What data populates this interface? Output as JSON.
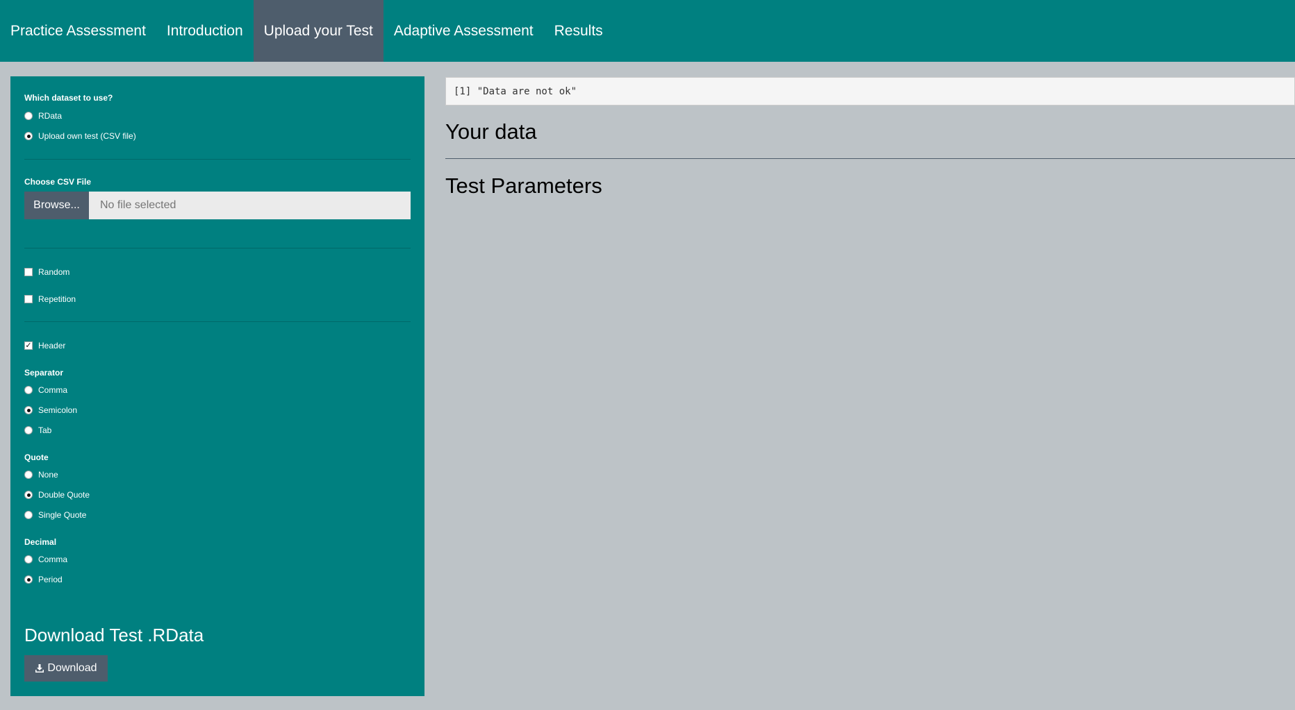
{
  "navbar": {
    "brand": "Practice Assessment",
    "tabs": [
      {
        "label": "Introduction"
      },
      {
        "label": "Upload your Test"
      },
      {
        "label": "Adaptive Assessment"
      },
      {
        "label": "Results"
      }
    ],
    "active_tab": "Upload your Test",
    "background": "#008080",
    "active_background": "#4e5d6c"
  },
  "sidebar": {
    "dataset": {
      "label": "Which dataset to use?",
      "options": [
        "RData",
        "Upload own test (CSV file)"
      ],
      "selected": "Upload own test (CSV file)"
    },
    "file": {
      "label": "Choose CSV File",
      "button": "Browse...",
      "placeholder": "No file selected"
    },
    "options": {
      "random": {
        "label": "Random",
        "checked": false
      },
      "repetition": {
        "label": "Repetition",
        "checked": false
      },
      "header": {
        "label": "Header",
        "checked": true
      }
    },
    "separator": {
      "label": "Separator",
      "options": [
        "Comma",
        "Semicolon",
        "Tab"
      ],
      "selected": "Semicolon"
    },
    "quote": {
      "label": "Quote",
      "options": [
        "None",
        "Double Quote",
        "Single Quote"
      ],
      "selected": "Double Quote"
    },
    "decimal": {
      "label": "Decimal",
      "options": [
        "Comma",
        "Period"
      ],
      "selected": "Period"
    },
    "download": {
      "title": "Download Test .RData",
      "button": "Download",
      "icon": "download-icon"
    }
  },
  "main": {
    "console_output": "[1] \"Data are not ok\"",
    "your_data_heading": "Your data",
    "test_parameters_heading": "Test Parameters"
  }
}
